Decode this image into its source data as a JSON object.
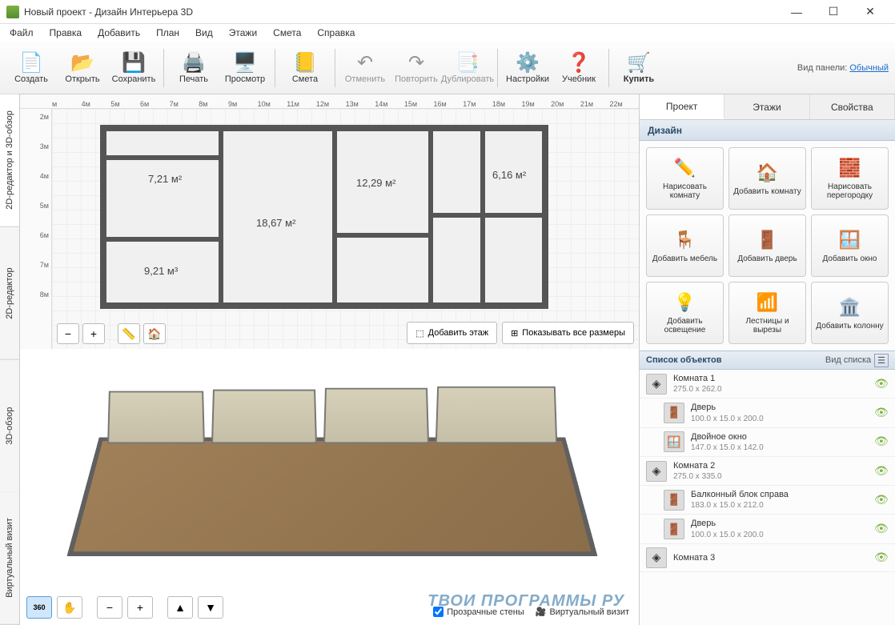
{
  "window": {
    "title": "Новый проект - Дизайн Интерьера 3D"
  },
  "menu": [
    "Файл",
    "Правка",
    "Добавить",
    "План",
    "Вид",
    "Этажи",
    "Смета",
    "Справка"
  ],
  "toolbar": {
    "create": "Создать",
    "open": "Открыть",
    "save": "Сохранить",
    "print": "Печать",
    "preview": "Просмотр",
    "estimate": "Смета",
    "undo": "Отменить",
    "redo": "Повторить",
    "duplicate": "Дублировать",
    "settings": "Настройки",
    "tutorial": "Учебник",
    "buy": "Купить",
    "panel_label": "Вид панели:",
    "panel_mode": "Обычный"
  },
  "ruler_h": [
    "м",
    "4м",
    "5м",
    "6м",
    "7м",
    "8м",
    "9м",
    "10м",
    "11м",
    "12м",
    "13м",
    "14м",
    "15м",
    "16м",
    "17м",
    "18м",
    "19м",
    "20м",
    "21м",
    "22м"
  ],
  "ruler_v": [
    "2м",
    "3м",
    "4м",
    "5м",
    "6м",
    "7м",
    "8м"
  ],
  "vtabs": {
    "combined": "2D-редактор и 3D-обзор",
    "editor2d": "2D-редактор",
    "view3d": "3D-обзор",
    "virtual": "Виртуальный визит"
  },
  "rooms": {
    "r1": "7,21 м²",
    "r2": "18,67 м²",
    "r3": "12,29 м²",
    "r4": "6,16 м²",
    "r5": "9,21 м³"
  },
  "plan_actions": {
    "add_floor": "Добавить этаж",
    "show_dims": "Показывать все размеры"
  },
  "view3d_opts": {
    "transparent_walls": "Прозрачные стены",
    "record_visit": "Виртуальный визит"
  },
  "right": {
    "tabs": {
      "project": "Проект",
      "floors": "Этажи",
      "props": "Свойства"
    },
    "design_head": "Дизайн",
    "design": [
      {
        "label": "Нарисовать комнату",
        "icon": "✏️"
      },
      {
        "label": "Добавить комнату",
        "icon": "🏠"
      },
      {
        "label": "Нарисовать перегородку",
        "icon": "🧱"
      },
      {
        "label": "Добавить мебель",
        "icon": "🪑"
      },
      {
        "label": "Добавить дверь",
        "icon": "🚪"
      },
      {
        "label": "Добавить окно",
        "icon": "🪟"
      },
      {
        "label": "Добавить освещение",
        "icon": "💡"
      },
      {
        "label": "Лестницы и вырезы",
        "icon": "📶"
      },
      {
        "label": "Добавить колонну",
        "icon": "🏛️"
      }
    ],
    "objects_head": "Список объектов",
    "list_mode": "Вид списка",
    "objects": [
      {
        "name": "Комната 1",
        "dims": "275.0 x 262.0",
        "icon": "◈",
        "indent": false
      },
      {
        "name": "Дверь",
        "dims": "100.0 x 15.0 x 200.0",
        "icon": "🚪",
        "indent": true
      },
      {
        "name": "Двойное окно",
        "dims": "147.0 x 15.0 x 142.0",
        "icon": "🪟",
        "indent": true
      },
      {
        "name": "Комната 2",
        "dims": "275.0 x 335.0",
        "icon": "◈",
        "indent": false
      },
      {
        "name": "Балконный блок справа",
        "dims": "183.0 x 15.0 x 212.0",
        "icon": "🚪",
        "indent": true
      },
      {
        "name": "Дверь",
        "dims": "100.0 x 15.0 x 200.0",
        "icon": "🚪",
        "indent": true
      },
      {
        "name": "Комната 3",
        "dims": "",
        "icon": "◈",
        "indent": false
      }
    ]
  },
  "watermark": "ТВОИ ПРОГРАММЫ РУ"
}
